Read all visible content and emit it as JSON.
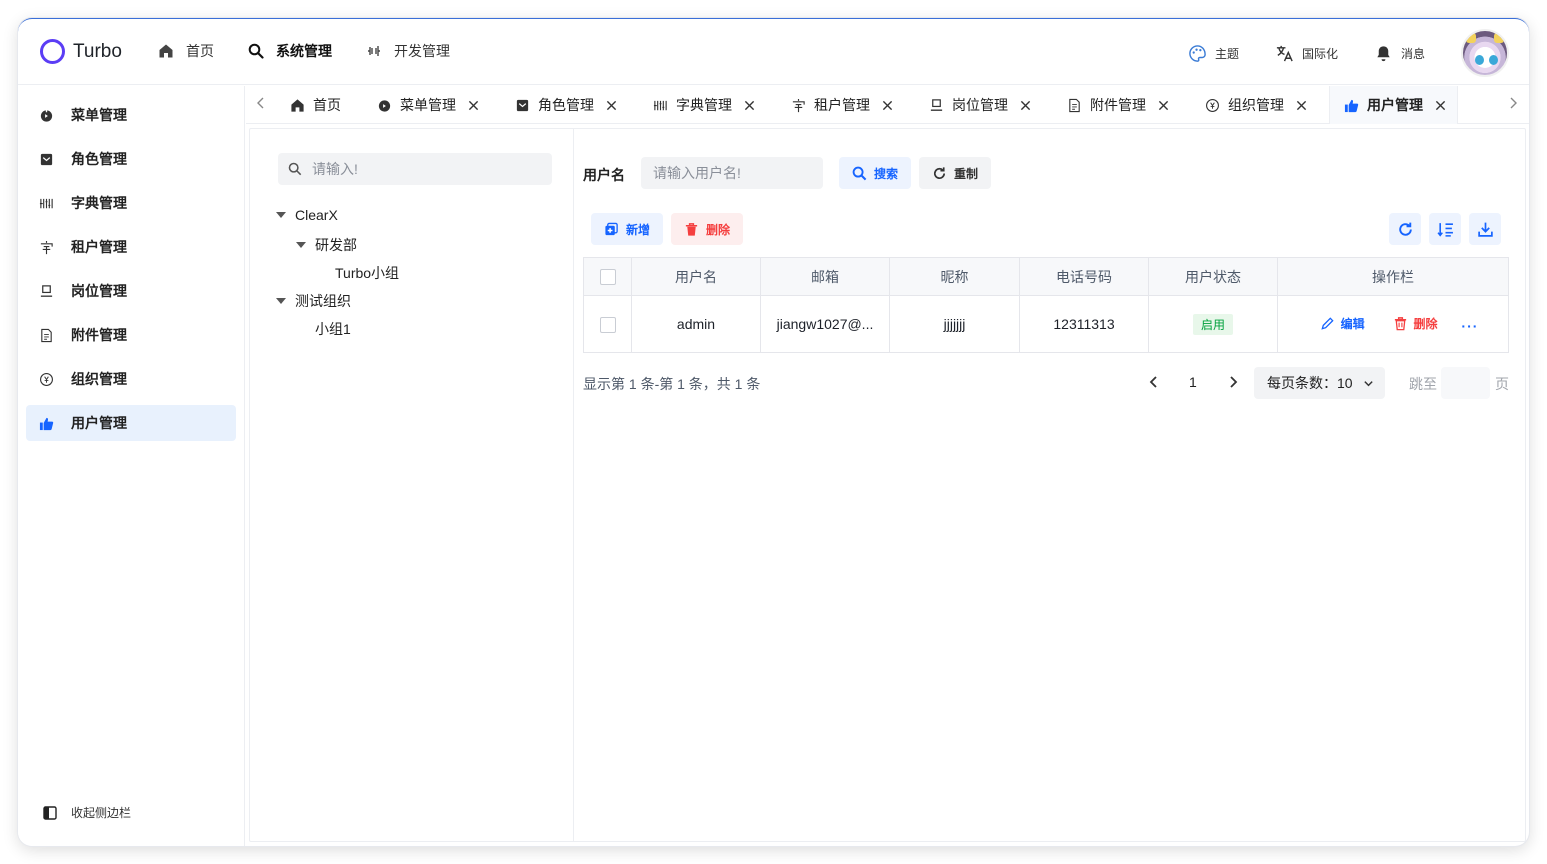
{
  "app": {
    "name": "Turbo",
    "accent": "#1664ff",
    "logo_color": "#5b3df5"
  },
  "topnav": [
    {
      "label": "首页",
      "icon": "home-icon"
    },
    {
      "label": "系统管理",
      "icon": "search-icon",
      "active": true
    },
    {
      "label": "开发管理",
      "icon": "dev-icon"
    }
  ],
  "header_right": {
    "theme": "主题",
    "i18n": "国际化",
    "messages": "消息"
  },
  "sidebar": {
    "items": [
      {
        "label": "菜单管理",
        "icon": "menu-icon"
      },
      {
        "label": "角色管理",
        "icon": "role-icon"
      },
      {
        "label": "字典管理",
        "icon": "dictionary-icon"
      },
      {
        "label": "租户管理",
        "icon": "tenant-icon"
      },
      {
        "label": "岗位管理",
        "icon": "post-icon"
      },
      {
        "label": "附件管理",
        "icon": "file-icon"
      },
      {
        "label": "组织管理",
        "icon": "org-icon"
      },
      {
        "label": "用户管理",
        "icon": "thumbs-up-icon",
        "active": true
      }
    ],
    "collapse_label": "收起侧边栏"
  },
  "tabs": [
    {
      "label": "首页",
      "closable": false
    },
    {
      "label": "菜单管理",
      "closable": true
    },
    {
      "label": "角色管理",
      "closable": true
    },
    {
      "label": "字典管理",
      "closable": true
    },
    {
      "label": "租户管理",
      "closable": true
    },
    {
      "label": "岗位管理",
      "closable": true
    },
    {
      "label": "附件管理",
      "closable": true
    },
    {
      "label": "组织管理",
      "closable": true
    },
    {
      "label": "用户管理",
      "closable": true,
      "active": true
    }
  ],
  "tree": {
    "search_placeholder": "请输入!",
    "nodes": [
      {
        "label": "ClearX",
        "level": 0,
        "expanded": true
      },
      {
        "label": "研发部",
        "level": 1,
        "expanded": true
      },
      {
        "label": "Turbo小组",
        "level": 2
      },
      {
        "label": "测试组织",
        "level": 0,
        "expanded": true
      },
      {
        "label": "小组1",
        "level": 1
      }
    ]
  },
  "filter": {
    "label": "用户名",
    "placeholder": "请输入用户名!",
    "search_label": "搜索",
    "reset_label": "重制"
  },
  "toolbar": {
    "add_label": "新增",
    "delete_label": "删除"
  },
  "table": {
    "columns": [
      "用户名",
      "邮箱",
      "昵称",
      "电话号码",
      "用户状态",
      "操作栏"
    ],
    "rows": [
      {
        "username": "admin",
        "email": "jiangw1027@...",
        "nickname": "jjjjjjj",
        "phone": "12311313",
        "status": "启用"
      }
    ],
    "actions": {
      "edit": "编辑",
      "delete": "删除",
      "more": "···"
    }
  },
  "pagination": {
    "info": "显示第 1 条-第 1 条，共 1 条",
    "current_page": "1",
    "page_size": "每页条数：10",
    "jump_label": "跳至",
    "page_label": "页"
  }
}
